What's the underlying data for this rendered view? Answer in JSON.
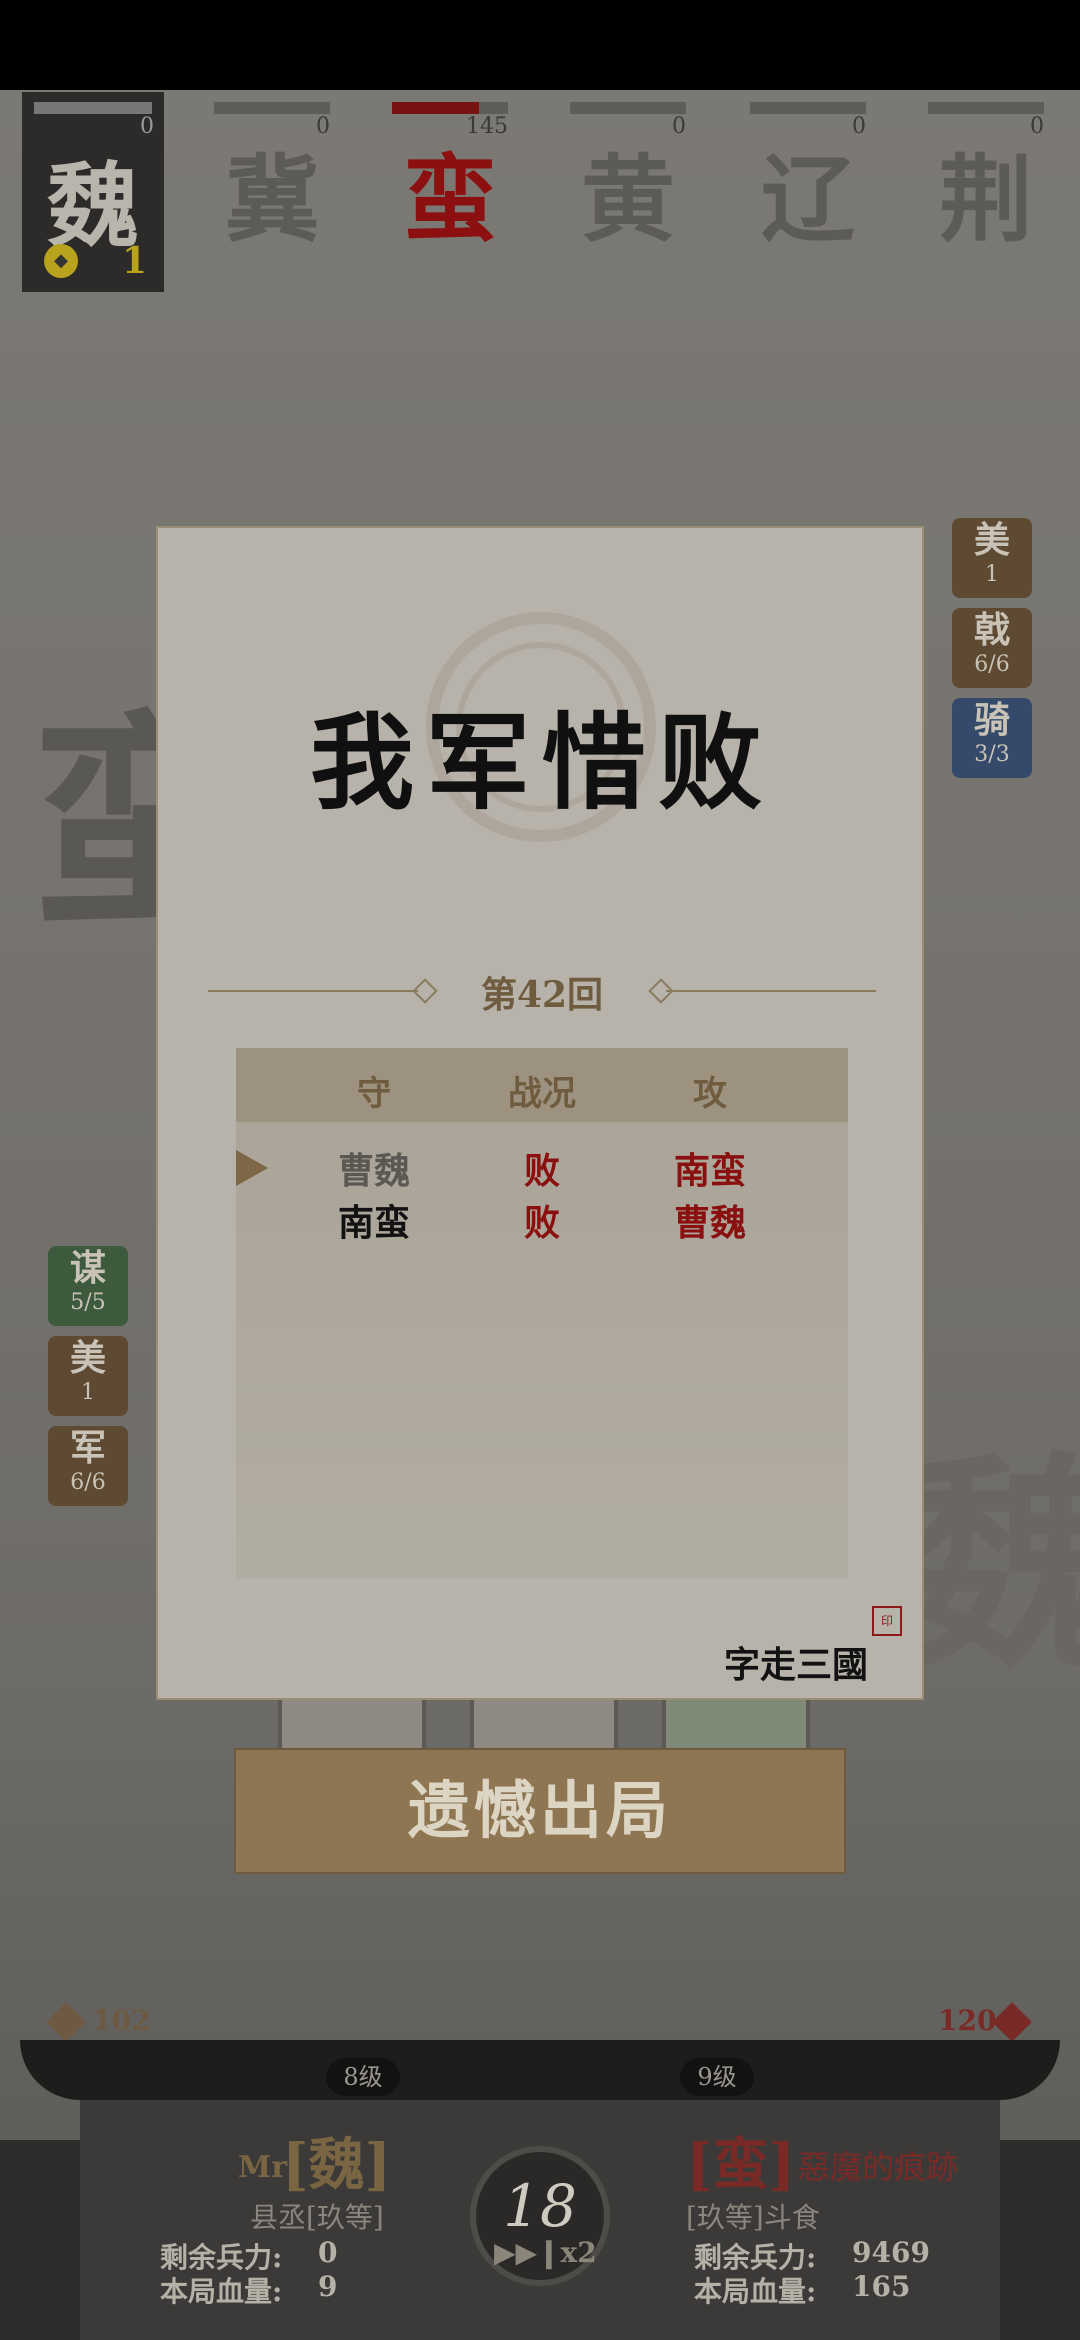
{
  "factions": [
    {
      "name": "魏",
      "score": "0",
      "coins": "1",
      "current": true
    },
    {
      "name": "冀",
      "score": "0"
    },
    {
      "name": "蛮",
      "score": "145",
      "active": true,
      "progress": 0.75
    },
    {
      "name": "黄",
      "score": "0"
    },
    {
      "name": "辽",
      "score": "0"
    },
    {
      "name": "荆",
      "score": "0"
    }
  ],
  "background": {
    "left_char": "蛮",
    "right_char": "魏"
  },
  "right_badges": [
    {
      "title": "美",
      "sub": "1"
    },
    {
      "title": "戟",
      "sub": "6/6"
    },
    {
      "title": "骑",
      "sub": "3/3"
    }
  ],
  "left_badges": [
    {
      "title": "谋",
      "sub": "5/5"
    },
    {
      "title": "美",
      "sub": "1"
    },
    {
      "title": "军",
      "sub": "6/6"
    }
  ],
  "dialog": {
    "title": "我军惜败",
    "round": "第42回",
    "headers": [
      "守",
      "战况",
      "攻"
    ],
    "rows": [
      {
        "def": "曹魏",
        "result": "败",
        "atk": "南蛮",
        "current": true
      },
      {
        "def": "南蛮",
        "result": "败",
        "atk": "曹魏"
      }
    ],
    "brand": "字走三國",
    "seal": "印"
  },
  "exit_button": "遗憾出局",
  "colors": {
    "accent_red": "#8a0f0f",
    "gold": "#b9a21d",
    "button": "#8f7653"
  },
  "bottom": {
    "left_score": "102",
    "right_score": "120",
    "left_level": "8级",
    "right_level": "9级",
    "player": {
      "prefix": "Mr",
      "name": "[魏]",
      "rank": "县丞[玖等]",
      "troops_label": "剩余兵力:",
      "troops": "0",
      "hp_label": "本局血量:",
      "hp": "9"
    },
    "enemy": {
      "name": "[蛮]",
      "nickname": "惡魔的痕跡",
      "rank": "[玖等]斗食",
      "troops_label": "剩余兵力:",
      "troops": "9469",
      "hp_label": "本局血量:",
      "hp": "165"
    },
    "round": "18",
    "speed": "▶▶❙x2"
  }
}
